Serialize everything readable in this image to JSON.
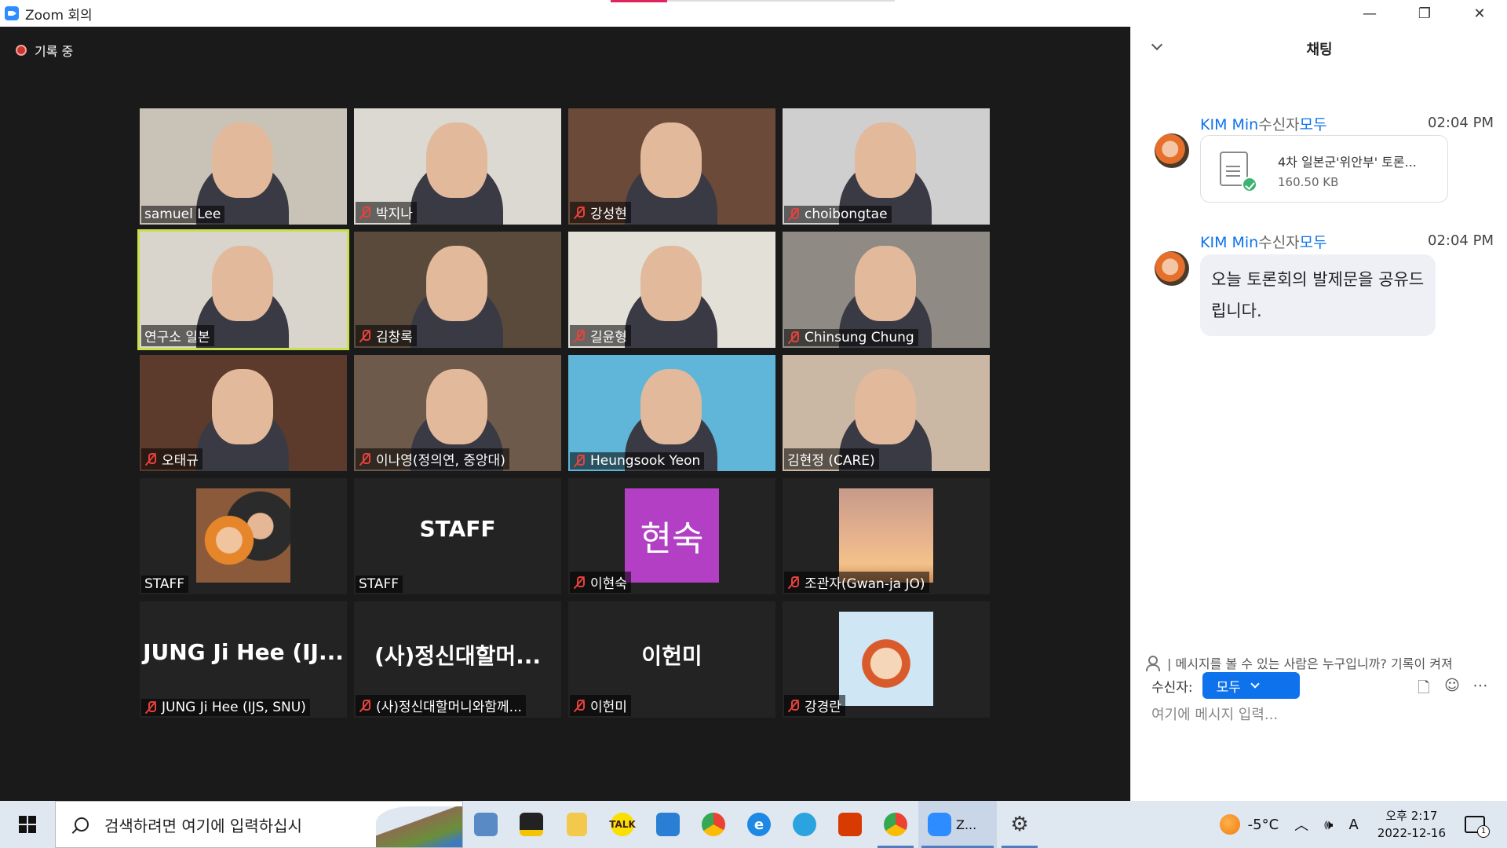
{
  "window": {
    "title": "Zoom 회의",
    "minimize": "—",
    "restore": "❐",
    "close": "✕"
  },
  "recording": {
    "label": "기록 중"
  },
  "participants": [
    {
      "name": "samuel Lee",
      "muted": false,
      "video": true,
      "bg": "#c9c2b6"
    },
    {
      "name": "박지나",
      "muted": true,
      "video": true,
      "bg": "#dcd9d2"
    },
    {
      "name": "강성현",
      "muted": true,
      "video": true,
      "bg": "#6b4a3a"
    },
    {
      "name": "choibongtae",
      "muted": true,
      "video": true,
      "bg": "#cfcfcf"
    },
    {
      "name": "연구소 일본",
      "muted": false,
      "video": true,
      "bg": "#d9d4cc",
      "active": true
    },
    {
      "name": "김창록",
      "muted": true,
      "video": true,
      "bg": "#5a4a3c"
    },
    {
      "name": "길윤형",
      "muted": true,
      "video": true,
      "bg": "#e3e0d8"
    },
    {
      "name": "Chinsung Chung",
      "muted": true,
      "video": true,
      "bg": "#8f8a84"
    },
    {
      "name": "오태규",
      "muted": true,
      "video": true,
      "bg": "#5c3a2c"
    },
    {
      "name": "이나영(정의연, 중앙대)",
      "muted": true,
      "video": true,
      "bg": "#6d5a4a"
    },
    {
      "name": "Heungsook Yeon",
      "muted": true,
      "video": true,
      "bg": "#5fb6d8"
    },
    {
      "name": "김현정 (CARE)",
      "muted": false,
      "video": true,
      "bg": "#cbb8a4"
    },
    {
      "name": "STAFF",
      "muted": false,
      "video": false,
      "avatar": "photo"
    },
    {
      "name": "STAFF",
      "muted": false,
      "video": false,
      "big": "STAFF"
    },
    {
      "name": "이현숙",
      "muted": true,
      "video": false,
      "avatar": "text",
      "avatar_text": "현숙",
      "avatar_color": "#b23fc4"
    },
    {
      "name": "조관자(Gwan-ja JO)",
      "muted": true,
      "video": false,
      "avatar": "sunset"
    },
    {
      "name": "JUNG Ji Hee (IJS, SNU)",
      "muted": true,
      "video": false,
      "big": "JUNG Ji Hee (IJ..."
    },
    {
      "name": "(사)정신대할머니와함께...",
      "muted": true,
      "video": false,
      "big": "(사)정신대할머..."
    },
    {
      "name": "이헌미",
      "muted": true,
      "video": false,
      "big": "이헌미"
    },
    {
      "name": "강경란",
      "muted": true,
      "video": false,
      "avatar": "cartoon"
    }
  ],
  "chat": {
    "title": "채팅",
    "messages": [
      {
        "sender": "KIM Min",
        "to_label": "수신자",
        "to": "모두",
        "time": "02:04 PM",
        "file_name": "4차 일본군'위안부' 토론...",
        "file_size": "160.50 KB"
      },
      {
        "sender": "KIM Min",
        "to_label": "수신자",
        "to": "모두",
        "time": "02:04 PM",
        "text": "오늘 토론회의 발제문을 공유드립니다."
      }
    ],
    "visibility_note": "| 메시지를 볼 수 있는 사람은 누구입니까? 기록이 켜져",
    "recipient_label": "수신자:",
    "recipient_value": "모두",
    "input_placeholder": "여기에 메시지 입력..."
  },
  "taskbar": {
    "search_placeholder": "검색하려면 여기에 입력하십시",
    "zoom_label": "Z...",
    "weather": "-5°C",
    "ime": "A",
    "time": "오후 2:17",
    "date": "2022-12-16",
    "notification_count": "1"
  }
}
